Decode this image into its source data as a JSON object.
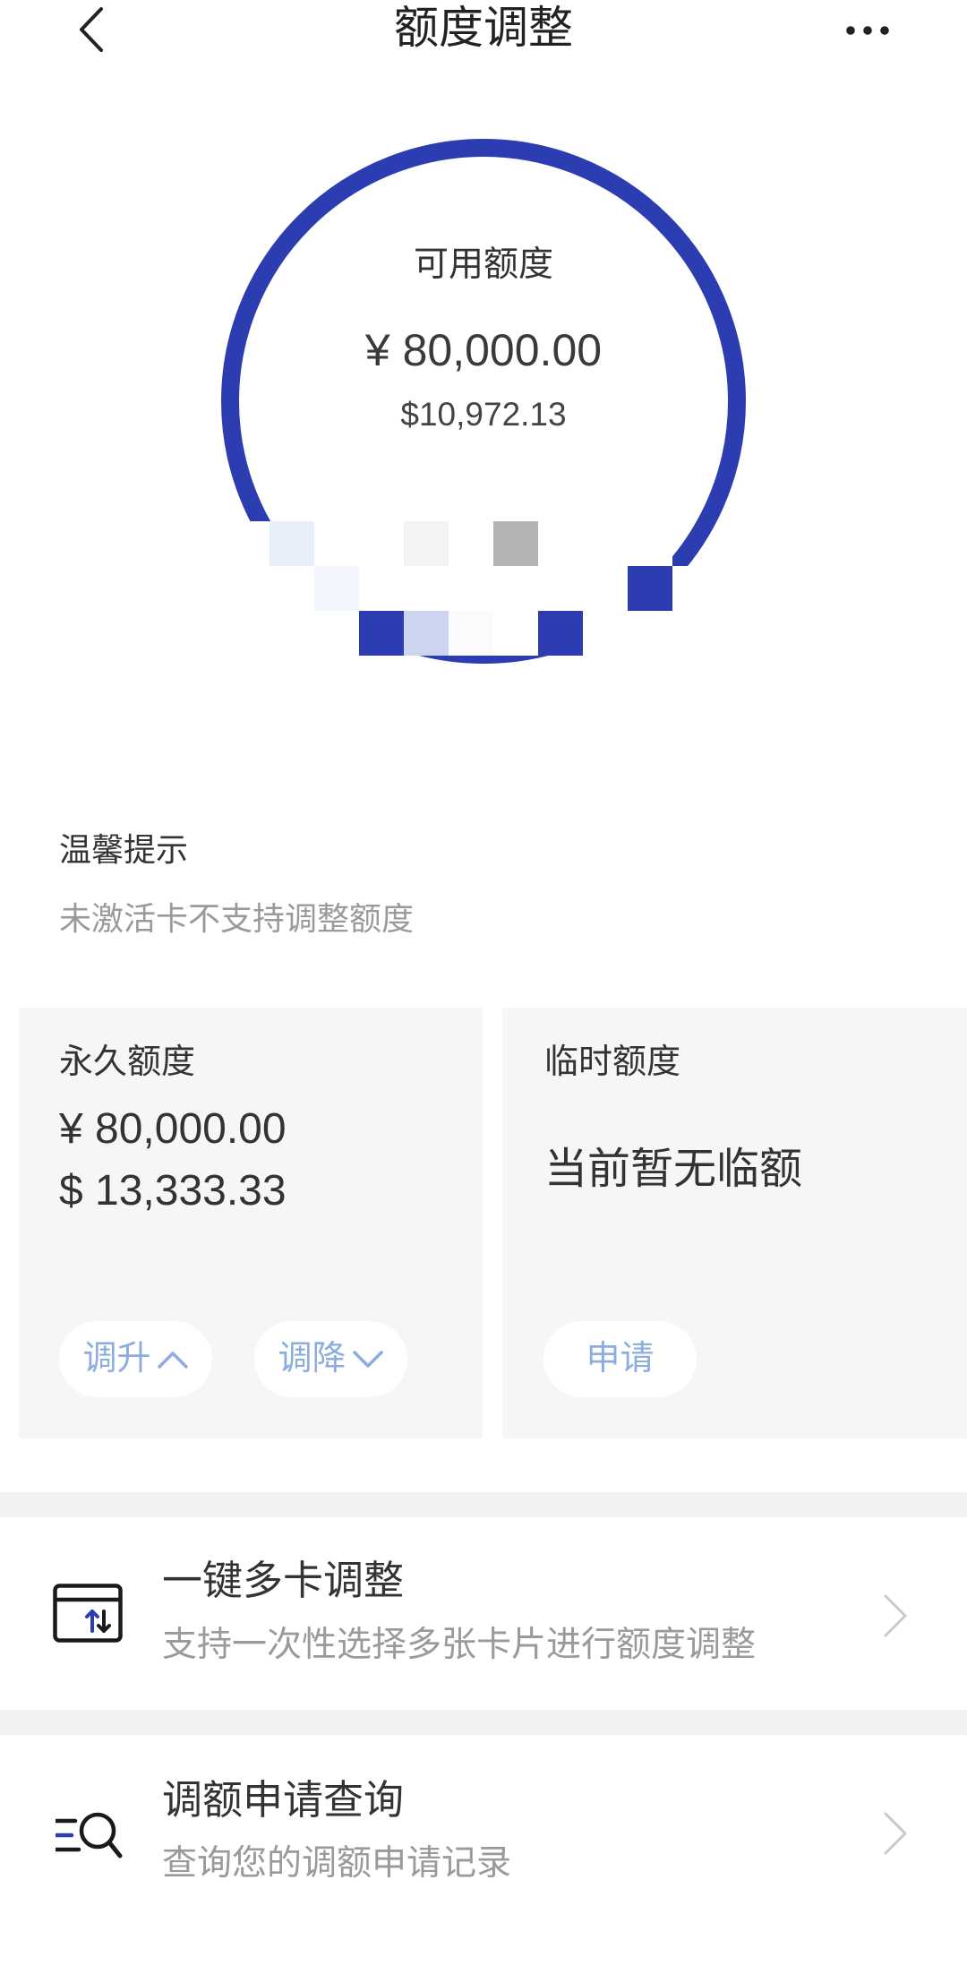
{
  "header": {
    "title": "额度调整",
    "back_icon": "chevron-left-icon",
    "more_icon": "more-icon"
  },
  "available": {
    "label": "可用额度",
    "cny": "¥ 80,000.00",
    "usd": "$10,972.13",
    "ring_fill": 1
  },
  "tip": {
    "title": "温馨提示",
    "text": "未激活卡不支持调整额度"
  },
  "permanent": {
    "label": "永久额度",
    "cny": "¥ 80,000.00",
    "usd": "$ 13,333.33",
    "increase_label": "调升",
    "increase_icon": "chevron-up-icon",
    "decrease_label": "调降",
    "decrease_icon": "chevron-down-icon"
  },
  "temporary": {
    "label": "临时额度",
    "status": "当前暂无临额",
    "apply_label": "申请"
  },
  "menu": {
    "items": [
      {
        "title": "一键多卡调整",
        "subtitle": "支持一次性选择多张卡片进行额度调整",
        "icon": "multi-card-adjust-icon"
      },
      {
        "title": "调额申请查询",
        "subtitle": "查询您的调额申请记录",
        "icon": "search-list-icon"
      }
    ]
  },
  "colors": {
    "accent": "#2b3db1",
    "pill_text": "#8cadde",
    "card_bg": "#f6f6f6",
    "divider": "#f2f2f2",
    "text_main": "#333333",
    "text_sub": "#9a9a9a"
  }
}
